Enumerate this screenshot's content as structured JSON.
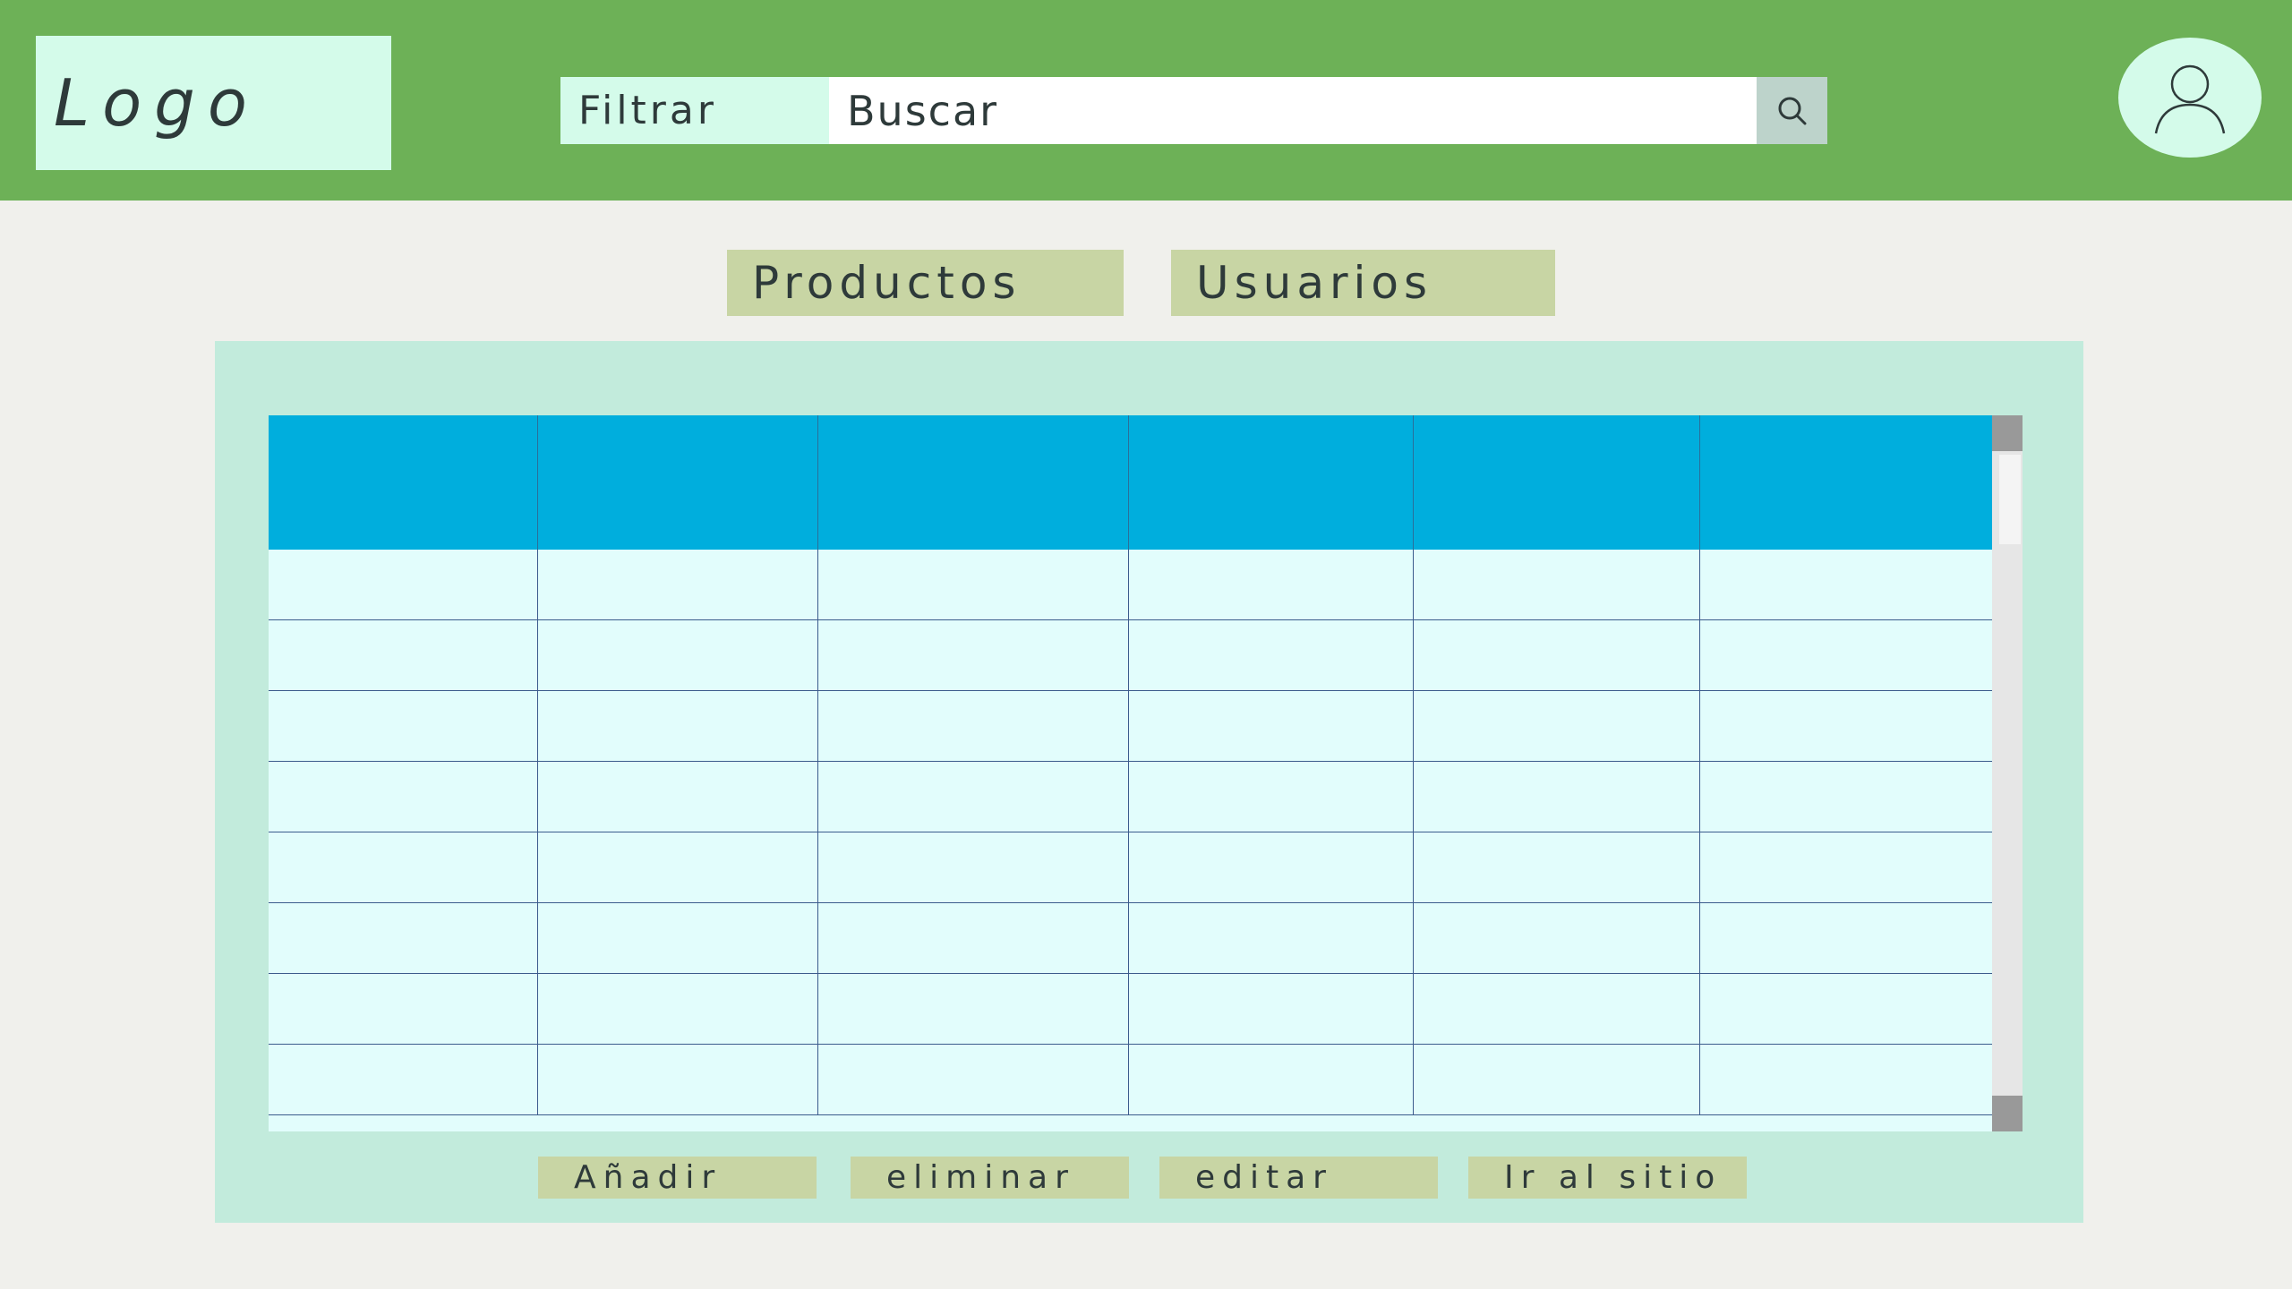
{
  "header": {
    "logo_text": "Logo",
    "filter_label": "Filtrar",
    "search_placeholder": "Buscar",
    "search_icon": "search-icon",
    "avatar_icon": "user-icon"
  },
  "tabs": [
    {
      "label": "Productos"
    },
    {
      "label": "Usuarios"
    }
  ],
  "table": {
    "columns": [
      "",
      "",
      "",
      "",
      "",
      ""
    ],
    "rows": [
      [
        "",
        "",
        "",
        "",
        "",
        ""
      ],
      [
        "",
        "",
        "",
        "",
        "",
        ""
      ],
      [
        "",
        "",
        "",
        "",
        "",
        ""
      ],
      [
        "",
        "",
        "",
        "",
        "",
        ""
      ],
      [
        "",
        "",
        "",
        "",
        "",
        ""
      ],
      [
        "",
        "",
        "",
        "",
        "",
        ""
      ],
      [
        "",
        "",
        "",
        "",
        "",
        ""
      ],
      [
        "",
        "",
        "",
        "",
        "",
        ""
      ]
    ]
  },
  "actions": {
    "add": "Añadir",
    "delete": "eliminar",
    "edit": "editar",
    "go": "Ir al sitio"
  },
  "colors": {
    "header_bg": "#6db157",
    "logo_bg": "#d4fbea",
    "tab_bg": "#c8d5a4",
    "panel_bg": "#c2ebdc",
    "table_header_bg": "#00aedd",
    "table_body_bg": "#e2fdfc"
  }
}
